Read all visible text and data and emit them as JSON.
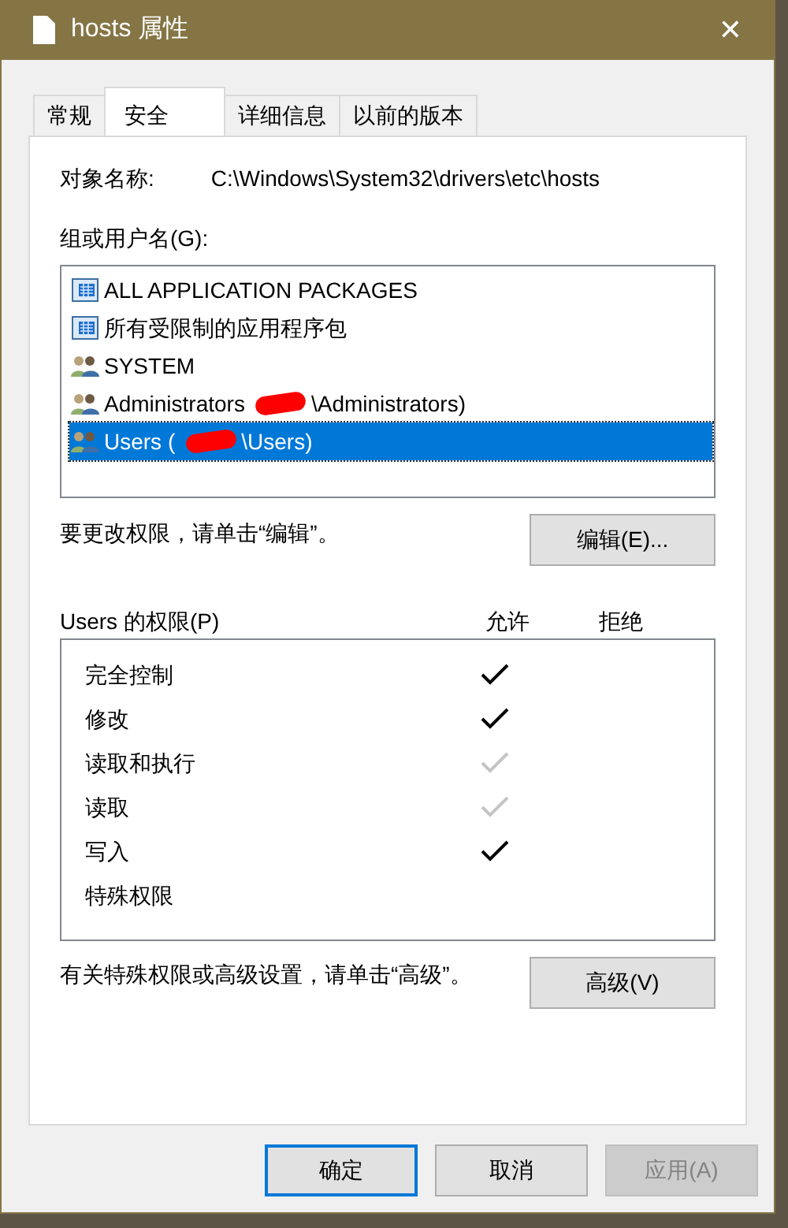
{
  "window": {
    "title": "hosts 属性",
    "close": "✕"
  },
  "tabs": [
    {
      "label": "常规",
      "selected": false
    },
    {
      "label": "安全",
      "selected": true
    },
    {
      "label": "详细信息",
      "selected": false
    },
    {
      "label": "以前的版本",
      "selected": false
    }
  ],
  "object_name": {
    "label": "对象名称:",
    "value": "C:\\Windows\\System32\\drivers\\etc\\hosts"
  },
  "groups": {
    "label": "组或用户名(G):",
    "items": [
      {
        "kind": "package",
        "text": "ALL APPLICATION PACKAGES",
        "selected": false
      },
      {
        "kind": "package",
        "text": "所有受限制的应用程序包",
        "selected": false
      },
      {
        "kind": "group",
        "text": "SYSTEM",
        "selected": false
      },
      {
        "kind": "group",
        "text": "Administrators",
        "redacted_suffix": "\\Administrators)",
        "selected": false
      },
      {
        "kind": "group",
        "text": "Users (",
        "redacted_suffix": "\\Users)",
        "selected": true
      }
    ]
  },
  "edit_hint": "要更改权限，请单击“编辑”。",
  "edit_button": "编辑(E)...",
  "permissions": {
    "label": "Users 的权限(P)",
    "allow_header": "允许",
    "deny_header": "拒绝",
    "rows": [
      {
        "name": "完全控制",
        "allow": true,
        "allow_disabled": false,
        "deny": false
      },
      {
        "name": "修改",
        "allow": true,
        "allow_disabled": false,
        "deny": false
      },
      {
        "name": "读取和执行",
        "allow": true,
        "allow_disabled": true,
        "deny": false
      },
      {
        "name": "读取",
        "allow": true,
        "allow_disabled": true,
        "deny": false
      },
      {
        "name": "写入",
        "allow": true,
        "allow_disabled": false,
        "deny": false
      },
      {
        "name": "特殊权限",
        "allow": false,
        "deny": false
      }
    ]
  },
  "advanced_hint": "有关特殊权限或高级设置，请单击“高级”。",
  "advanced_button": "高级(V)",
  "buttons": [
    {
      "label": "确定",
      "kind": "default",
      "disabled": false
    },
    {
      "label": "取消",
      "kind": "normal",
      "disabled": false
    },
    {
      "label": "应用(A)",
      "kind": "normal",
      "disabled": true
    }
  ]
}
